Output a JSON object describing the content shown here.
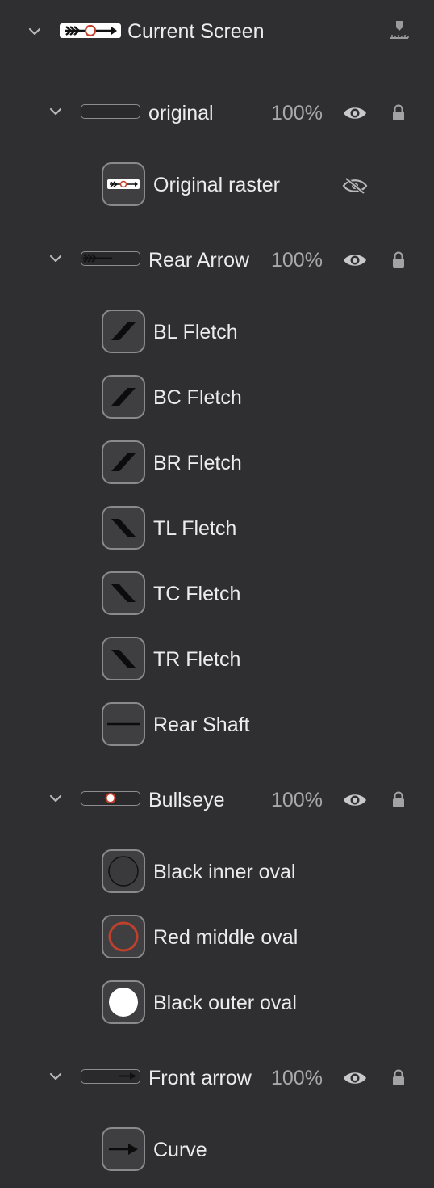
{
  "root": {
    "title": "Current Screen",
    "icon": "arrow-target-thumbnail",
    "action_icon": "ruler-pin-icon"
  },
  "groups": [
    {
      "label": "original",
      "opacity": "100%",
      "thumbnail": "empty-thumbnail",
      "children": [
        {
          "label": "Original raster",
          "icon": "arrow-raster-thumbnail",
          "hidden": true
        }
      ]
    },
    {
      "label": "Rear Arrow",
      "opacity": "100%",
      "thumbnail": "rear-arrow-thumbnail",
      "children": [
        {
          "label": "BL Fletch",
          "icon": "fletch-up-thumbnail"
        },
        {
          "label": "BC Fletch",
          "icon": "fletch-up-thumbnail"
        },
        {
          "label": "BR Fletch",
          "icon": "fletch-up-thumbnail"
        },
        {
          "label": "TL Fletch",
          "icon": "fletch-down-thumbnail"
        },
        {
          "label": "TC Fletch",
          "icon": "fletch-down-thumbnail"
        },
        {
          "label": "TR Fletch",
          "icon": "fletch-down-thumbnail"
        },
        {
          "label": "Rear Shaft",
          "icon": "line-thumbnail"
        }
      ]
    },
    {
      "label": "Bullseye",
      "opacity": "100%",
      "thumbnail": "bullseye-thumbnail",
      "children": [
        {
          "label": "Black inner oval",
          "icon": "dark-circle-thumbnail"
        },
        {
          "label": "Red middle oval",
          "icon": "red-ring-thumbnail"
        },
        {
          "label": "Black outer oval",
          "icon": "white-circle-thumbnail"
        }
      ]
    },
    {
      "label": "Front arrow",
      "opacity": "100%",
      "thumbnail": "front-arrow-thumbnail",
      "children": [
        {
          "label": "Curve",
          "icon": "arrow-curve-thumbnail"
        }
      ]
    }
  ],
  "colors": {
    "background": "#2f2f31",
    "text": "#ececec",
    "muted": "#a9a9ab",
    "accent_red": "#c0402c"
  }
}
